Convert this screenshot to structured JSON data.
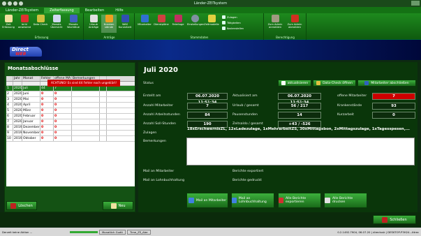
{
  "window": {
    "title": "Länder-ZEITsystem"
  },
  "tabs": [
    "Länder-ZEITsystem",
    "Zeiterfassung",
    "Bearbeiten",
    "Hilfe"
  ],
  "ribbon": {
    "groups": [
      {
        "label": "Erfassung",
        "buttons": [
          "Zeit Erfassung",
          "Ist kl anwesend",
          "Data Check",
          "Monats Übersicht",
          "Monats Wochtäue"
        ]
      },
      {
        "label": "Anträge",
        "buttons": [
          "Urlaub Anträge",
          "Kranken stände",
          "WAS Kurzarbeit"
        ]
      },
      {
        "label": "Stammdaten",
        "buttons": [
          "Mitarbeiter",
          "Dienstpläne",
          "Feiertage",
          "Einstellungen",
          "Zeitmodelle"
        ],
        "mini": [
          "Zulagen",
          "Tätigkeiten",
          "Kostenstellen"
        ]
      },
      {
        "label": "Berechtigung",
        "buttons": [
          "Zum Admin anmelden",
          "Zum Admin abmelden"
        ]
      }
    ]
  },
  "banner": {
    "logo": "Direct",
    "logo_sub": "WEB"
  },
  "left": {
    "title": "Monatsabschlüsse",
    "headers": [
      "",
      "Jahr",
      "Monat",
      "Fehler",
      "offene MA",
      "Bemerkungen"
    ],
    "rows": [
      {
        "n": "1",
        "jahr": "2020",
        "monat": "Juli",
        "fehler": "44",
        "offene": "7",
        "bem": ""
      },
      {
        "n": "2",
        "jahr": "2020",
        "monat": "Juni",
        "fehler": "0",
        "offene": "0",
        "bem": ""
      },
      {
        "n": "3",
        "jahr": "2020",
        "monat": "Mai",
        "fehler": "0",
        "offene": "0",
        "bem": ""
      },
      {
        "n": "4",
        "jahr": "2020",
        "monat": "April",
        "fehler": "0",
        "offene": "0",
        "bem": ""
      },
      {
        "n": "5",
        "jahr": "2020",
        "monat": "März",
        "fehler": "0",
        "offene": "0",
        "bem": ""
      },
      {
        "n": "6",
        "jahr": "2020",
        "monat": "Februar",
        "fehler": "0",
        "offene": "0",
        "bem": ""
      },
      {
        "n": "7",
        "jahr": "2020",
        "monat": "Januar",
        "fehler": "0",
        "offene": "0",
        "bem": ""
      },
      {
        "n": "8",
        "jahr": "2019",
        "monat": "Dezember",
        "fehler": "0",
        "offene": "0",
        "bem": ""
      },
      {
        "n": "9",
        "jahr": "2019",
        "monat": "November",
        "fehler": "0",
        "offene": "0",
        "bem": ""
      },
      {
        "n": "10",
        "jahr": "2019",
        "monat": "Oktober",
        "fehler": "0",
        "offene": "0",
        "bem": ""
      }
    ],
    "delete_label": "Löschen",
    "new_label": "Neu"
  },
  "right": {
    "title": "Juli 2020",
    "status_label": "Status",
    "status_value": "ACHTUNG! Es sind 44 Fehler noch ungeklärt!",
    "btn_refresh": "aktualisieren",
    "btn_datacheck": "Data-Check öffnen",
    "btn_close_emp": "Mitarbeiter abschließen",
    "erstellt_label": "Erstellt am",
    "erstellt_value": "06.07.2020 11:51:34",
    "aktualisiert_label": "Aktualisiert am",
    "aktualisiert_value": "06.07.2020 11:51:34",
    "offene_label": "offene Mitarbeiter",
    "offene_value": "7",
    "anzahl_ma_label": "Anzahl Mitarbeiter",
    "anzahl_ma_value": "7",
    "urlaub_label": "Urlaub / gesamt",
    "urlaub_value": "56 / 217",
    "kranken_label": "Krankenstände",
    "kranken_value": "93",
    "arbeitsstunden_label": "Anzahl Arbeitsstunden",
    "arbeitsstunden_value": "84",
    "pausen_label": "Pausenstunden",
    "pausen_value": "14",
    "kurzarbeit_label": "Kurzarbeit",
    "kurzarbeit_value": "0",
    "soll_label": "Anzahl Soll-Stunden",
    "soll_value": "190",
    "zeitsaldo_label": "Zeitsaldo / gesamt",
    "zeitsaldo_value": "+43 / -526",
    "zulagen_label": "Zulagen",
    "zulagen_value": "18xErschwernisZL, 12xLadezulage, 1xMehrarbeitZS, 30xMittagsbon, 2xMittagszulage, 1xTagesspesen,...",
    "bemerkungen_label": "Bemerkungen",
    "mail_ma_label": "Mail an Mitarbeiter",
    "mail_lohn_label": "Mail an Lohnbuchhaltung",
    "berichte_export_label": "Berichte exportiert",
    "berichte_druck_label": "Berichte gedruckt",
    "btn_mail_ma": "Mail an Mitarbeiter",
    "btn_mail_lohn": "Mail an Lohnbuchhaltung",
    "btn_export": "Alle Berichte exportieren",
    "btn_print": "Alle Berichte drucken"
  },
  "footer": {
    "close_label": "Schließen"
  },
  "statusbar": {
    "left": "Derzeit keine Aktion ...",
    "tab1": "Monatlich Gudti",
    "tab2": "Time_ZS_Ater",
    "right": "0.2.1492.7904, 06.07.20   |   directusk | DESKTOP-P3H24...ittrec"
  },
  "colors": {
    "accent": "#1e7a1e",
    "alert": "#cc0000",
    "banner": "#0a2a8a"
  }
}
